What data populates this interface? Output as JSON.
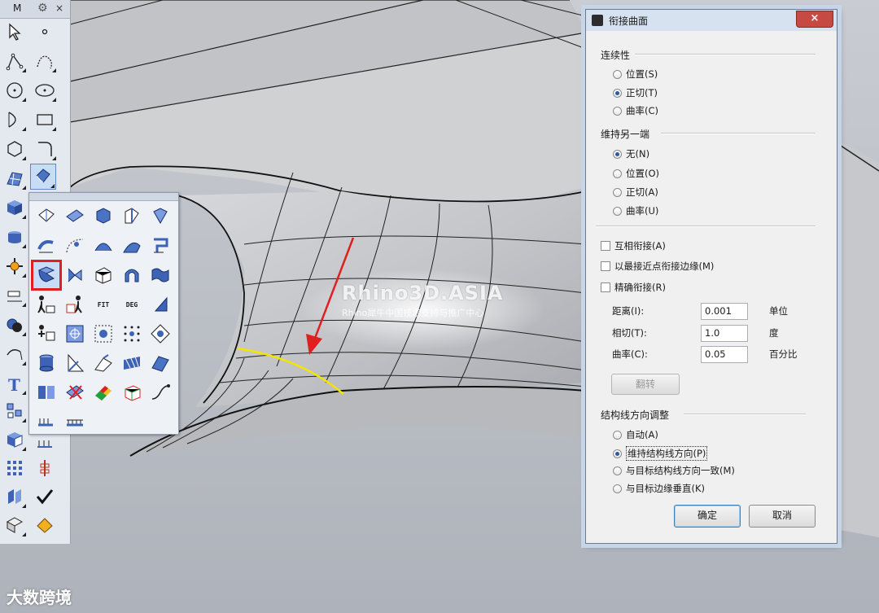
{
  "toolbar": {
    "title_initial": "M",
    "gear_icon": "gear-icon",
    "close_glyph": "×"
  },
  "flyout": {
    "label_fit": "FIT",
    "label_deg": "DEG"
  },
  "watermark": {
    "brand": "Rhino3D.ASIA",
    "subtitle": "Rhino犀牛中国技术支持与推广中心"
  },
  "corner_logo": "大数跨境",
  "dialog": {
    "title": "衔接曲面",
    "close_glyph": "×",
    "continuity": {
      "heading": "连续性",
      "options": [
        "位置(S)",
        "正切(T)",
        "曲率(C)"
      ],
      "selected": "正切(T)"
    },
    "maintain_other_end": {
      "heading": "维持另一端",
      "options": [
        "无(N)",
        "位置(O)",
        "正切(A)",
        "曲率(U)"
      ],
      "selected": "无(N)"
    },
    "checkboxes": [
      "互相衔接(A)",
      "以最接近点衔接边缘(M)",
      "精确衔接(R)"
    ],
    "fields": [
      {
        "label": "距离(I):",
        "value": "0.001",
        "unit": "单位"
      },
      {
        "label": "相切(T):",
        "value": "1.0",
        "unit": "度"
      },
      {
        "label": "曲率(C):",
        "value": "0.05",
        "unit": "百分比"
      }
    ],
    "flip_button": "翻转",
    "isocurve": {
      "heading": "结构线方向调整",
      "options": [
        "自动(A)",
        "维持结构线方向(P)",
        "与目标结构线方向一致(M)",
        "与目标边缘垂直(K)"
      ],
      "selected": "维持结构线方向(P)"
    },
    "ok_button": "确定",
    "cancel_button": "取消"
  },
  "colors": {
    "accent_red": "#e02020",
    "highlight_yellow": "#f2e600",
    "dialog_bg": "#f0f0f0"
  }
}
